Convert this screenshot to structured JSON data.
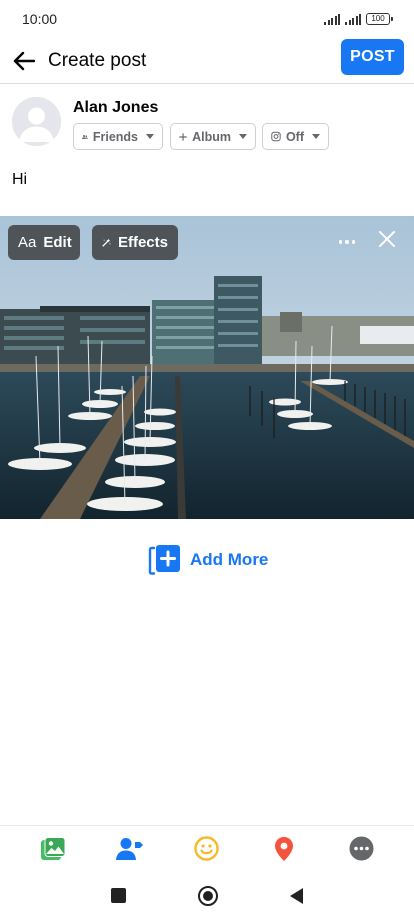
{
  "status_bar": {
    "time": "10:00",
    "battery": "100"
  },
  "header": {
    "title": "Create post",
    "post_label": "POST"
  },
  "composer": {
    "user_name": "Alan Jones",
    "audience_label": "Friends",
    "album_label": "Album",
    "instagram_label": "Off",
    "text": "Hi"
  },
  "photo": {
    "edit_label": "Edit",
    "edit_prefix": "Aa",
    "effects_label": "Effects"
  },
  "add_more_label": "Add More",
  "bottom_bar": {
    "icons": [
      "photo-icon",
      "tag-people-icon",
      "feeling-icon",
      "check-in-icon",
      "more-icon"
    ],
    "colors": {
      "photo": "#45bd62",
      "tag": "#1877f2",
      "feeling": "#f7b928",
      "checkin": "#f5533d",
      "more": "#65676b"
    }
  },
  "colors": {
    "accent": "#1877f2",
    "text": "#050505",
    "secondary": "#65676b"
  }
}
